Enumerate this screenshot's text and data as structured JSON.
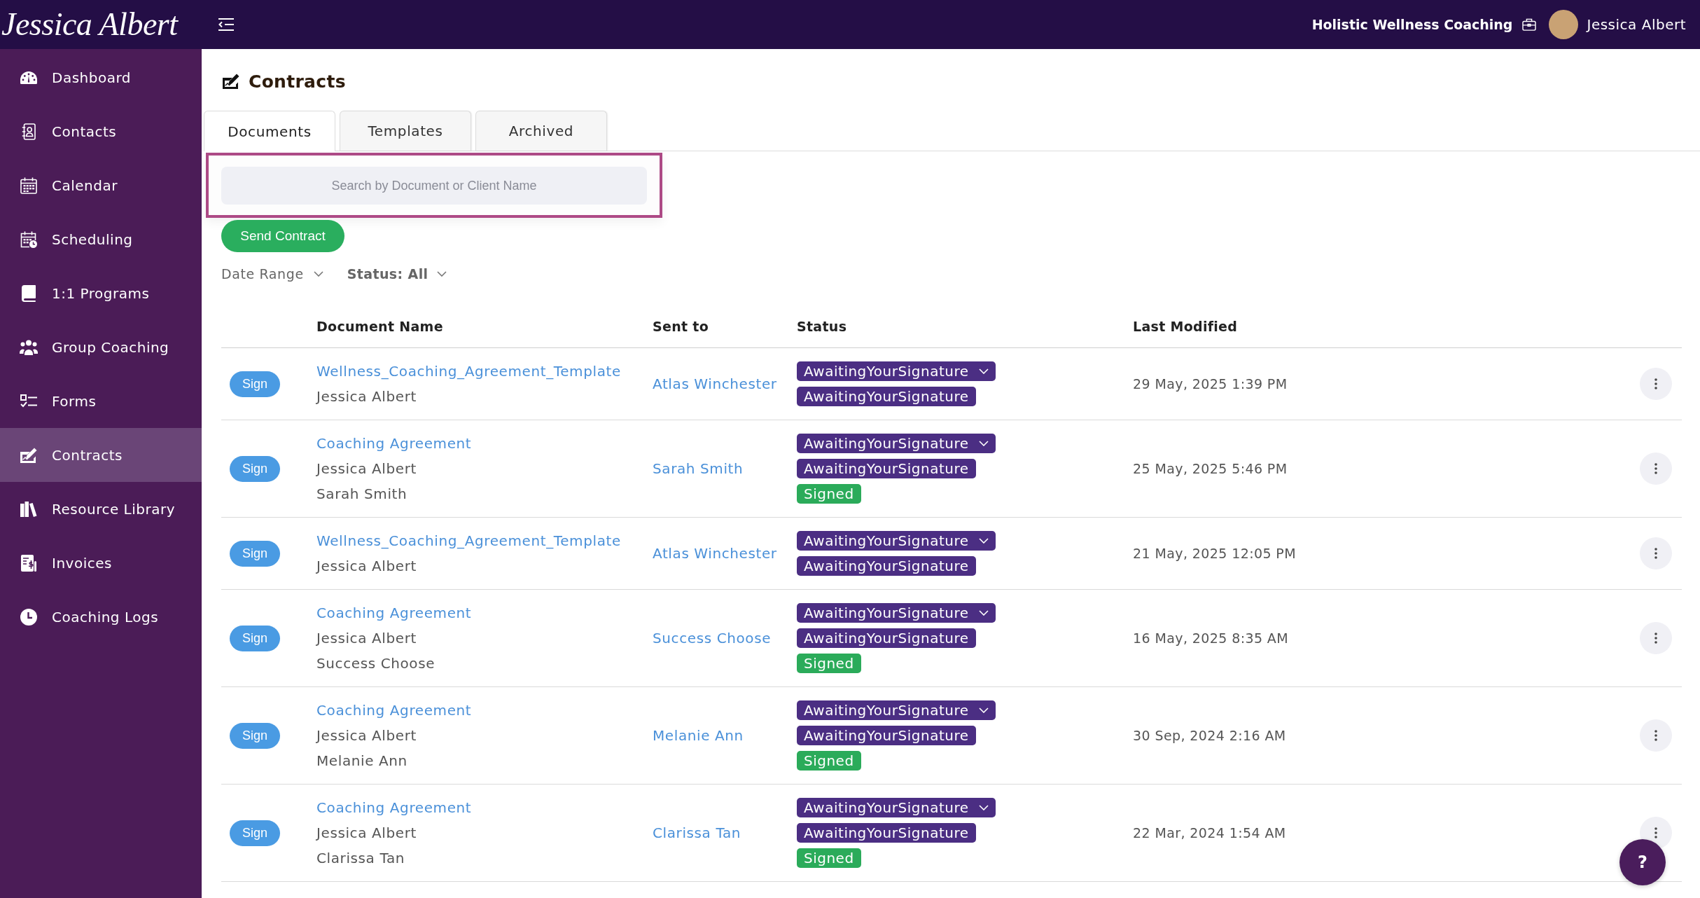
{
  "topbar": {
    "logo": "Jessica Albert",
    "business": "Holistic Wellness Coaching",
    "user": {
      "name": "Jessica Albert"
    }
  },
  "sidebar": {
    "items": [
      {
        "label": "Dashboard",
        "selected": false
      },
      {
        "label": "Contacts",
        "selected": false
      },
      {
        "label": "Calendar",
        "selected": false
      },
      {
        "label": "Scheduling",
        "selected": false
      },
      {
        "label": "1:1 Programs",
        "selected": false
      },
      {
        "label": "Group Coaching",
        "selected": false
      },
      {
        "label": "Forms",
        "selected": false
      },
      {
        "label": "Contracts",
        "selected": true
      },
      {
        "label": "Resource Library",
        "selected": false
      },
      {
        "label": "Invoices",
        "selected": false
      },
      {
        "label": "Coaching Logs",
        "selected": false
      }
    ]
  },
  "page": {
    "title": "Contracts"
  },
  "tabs": [
    {
      "label": "Documents",
      "selected": true
    },
    {
      "label": "Templates",
      "selected": false
    },
    {
      "label": "Archived",
      "selected": false
    }
  ],
  "search": {
    "placeholder": "Search by Document or Client Name"
  },
  "send_button": "Send Contract",
  "filters": [
    {
      "label": "Date Range",
      "kind": "date"
    },
    {
      "label": "Status: All",
      "kind": "status"
    }
  ],
  "table": {
    "columns": [
      "Document Name",
      "Sent to",
      "Status",
      "Last Modified"
    ],
    "rows": [
      {
        "action": "Sign",
        "document": "Wellness_Coaching_Agreement_Template",
        "parties": [
          "Jessica Albert"
        ],
        "sent_to": "Atlas Winchester",
        "statuses": [
          {
            "label": "AwaitingYourSignature",
            "kind": "dropdown",
            "color": "#4b2e83"
          },
          {
            "label": "AwaitingYourSignature",
            "kind": "tag",
            "color": "#4b2e83"
          }
        ],
        "last_modified": "29 May, 2025 1:39 PM"
      },
      {
        "action": "Sign",
        "document": "Coaching Agreement",
        "parties": [
          "Jessica Albert",
          "Sarah Smith"
        ],
        "sent_to": "Sarah Smith",
        "statuses": [
          {
            "label": "AwaitingYourSignature",
            "kind": "dropdown",
            "color": "#4b2e83"
          },
          {
            "label": "AwaitingYourSignature",
            "kind": "tag",
            "color": "#4b2e83"
          },
          {
            "label": "Signed",
            "kind": "tag",
            "color": "#2bab5a"
          }
        ],
        "last_modified": "25 May, 2025 5:46 PM"
      },
      {
        "action": "Sign",
        "document": "Wellness_Coaching_Agreement_Template",
        "parties": [
          "Jessica Albert"
        ],
        "sent_to": "Atlas Winchester",
        "statuses": [
          {
            "label": "AwaitingYourSignature",
            "kind": "dropdown",
            "color": "#4b2e83"
          },
          {
            "label": "AwaitingYourSignature",
            "kind": "tag",
            "color": "#4b2e83"
          }
        ],
        "last_modified": "21 May, 2025 12:05 PM"
      },
      {
        "action": "Sign",
        "document": "Coaching Agreement",
        "parties": [
          "Jessica Albert",
          "Success Choose"
        ],
        "sent_to": "Success Choose",
        "statuses": [
          {
            "label": "AwaitingYourSignature",
            "kind": "dropdown",
            "color": "#4b2e83"
          },
          {
            "label": "AwaitingYourSignature",
            "kind": "tag",
            "color": "#4b2e83"
          },
          {
            "label": "Signed",
            "kind": "tag",
            "color": "#2bab5a"
          }
        ],
        "last_modified": "16 May, 2025 8:35 AM"
      },
      {
        "action": "Sign",
        "document": "Coaching Agreement",
        "parties": [
          "Jessica Albert",
          "Melanie Ann"
        ],
        "sent_to": "Melanie Ann",
        "statuses": [
          {
            "label": "AwaitingYourSignature",
            "kind": "dropdown",
            "color": "#4b2e83"
          },
          {
            "label": "AwaitingYourSignature",
            "kind": "tag",
            "color": "#4b2e83"
          },
          {
            "label": "Signed",
            "kind": "tag",
            "color": "#2bab5a"
          }
        ],
        "last_modified": "30 Sep, 2024 2:16 AM"
      },
      {
        "action": "Sign",
        "document": "Coaching Agreement",
        "parties": [
          "Jessica Albert",
          "Clarissa Tan"
        ],
        "sent_to": "Clarissa Tan",
        "statuses": [
          {
            "label": "AwaitingYourSignature",
            "kind": "dropdown",
            "color": "#4b2e83"
          },
          {
            "label": "AwaitingYourSignature",
            "kind": "tag",
            "color": "#4b2e83"
          },
          {
            "label": "Signed",
            "kind": "tag",
            "color": "#2bab5a"
          }
        ],
        "last_modified": "22 Mar, 2024 1:54 AM"
      }
    ]
  },
  "help_button": "?"
}
